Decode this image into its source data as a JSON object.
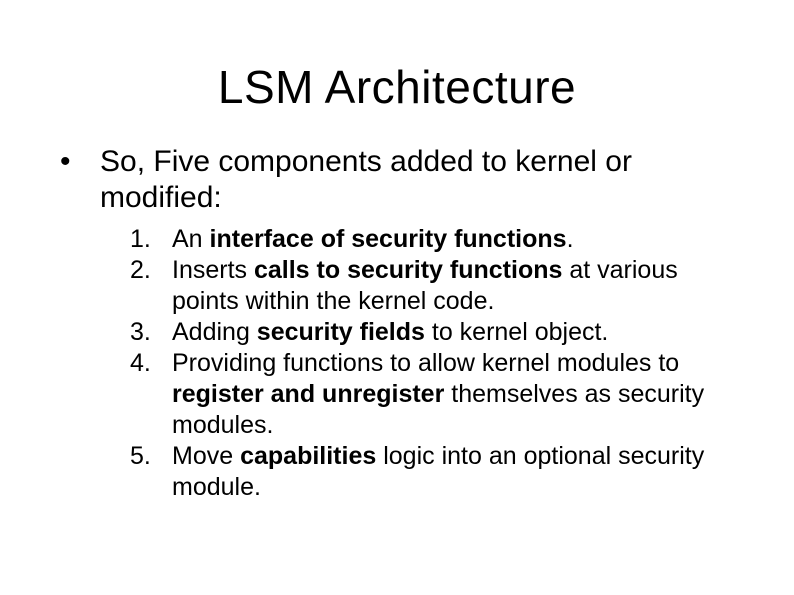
{
  "title": "LSM Architecture",
  "bullet": {
    "text": "So, Five components added to kernel or modified:"
  },
  "items": [
    {
      "num": "1.",
      "pre": "An ",
      "bold": "interface of security functions",
      "post": "."
    },
    {
      "num": "2.",
      "pre": "Inserts ",
      "bold": "calls to security functions",
      "post": " at various points within the kernel code."
    },
    {
      "num": "3.",
      "pre": "Adding ",
      "bold": "security fields",
      "post": " to kernel object."
    },
    {
      "num": "4.",
      "pre": "Providing functions to allow kernel modules to ",
      "bold": "register and unregister",
      "post": " themselves as security modules."
    },
    {
      "num": "5.",
      "pre": "Move ",
      "bold": "capabilities",
      "post": " logic into an optional security module."
    }
  ]
}
